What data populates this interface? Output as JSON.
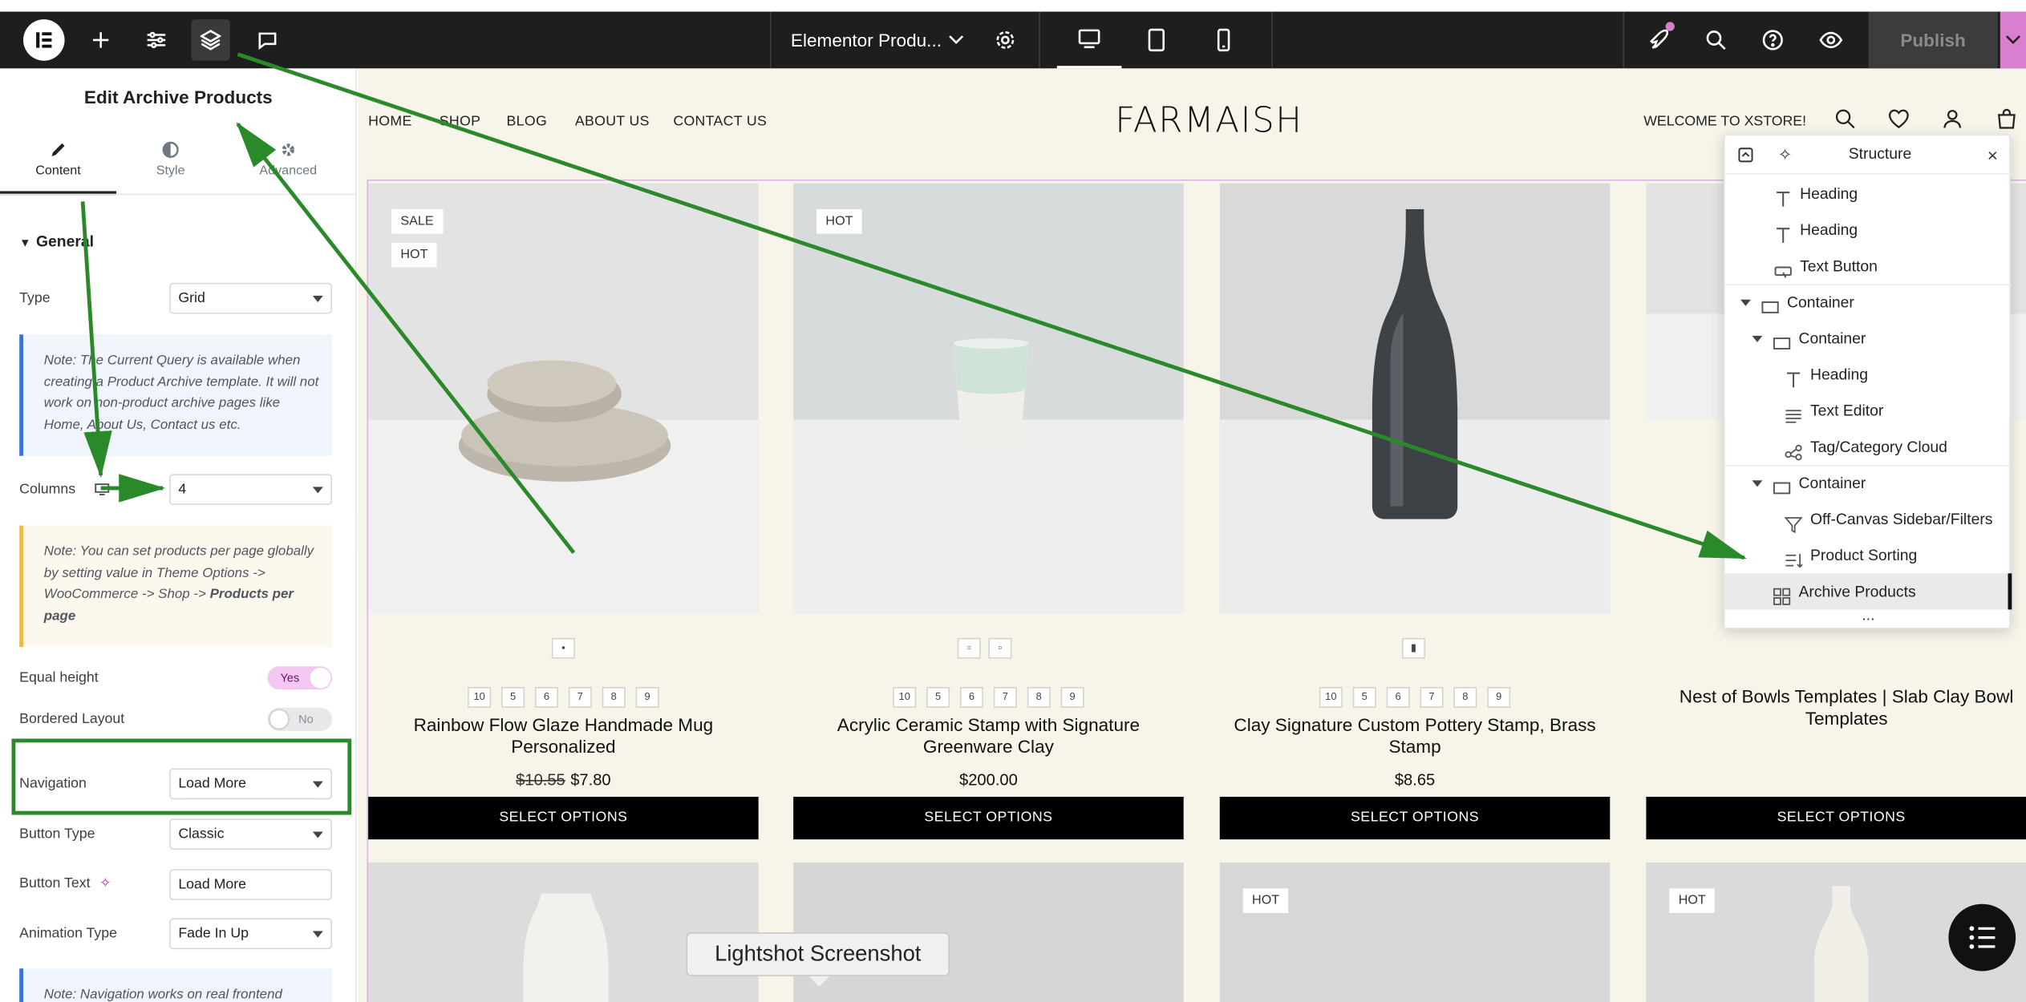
{
  "topbar": {
    "logo_letter": "E",
    "document_title": "Elementor Produ...",
    "publish_label": "Publish"
  },
  "panel": {
    "title": "Edit Archive Products",
    "tabs": [
      {
        "label": "Content",
        "icon": "pencil-icon"
      },
      {
        "label": "Style",
        "icon": "half-circle-icon"
      },
      {
        "label": "Advanced",
        "icon": "gear-icon"
      }
    ],
    "section_title": "General",
    "type_label": "Type",
    "type_value": "Grid",
    "note_query": "Note: The Current Query is available when creating a Product Archive template. It will not work on non-product archive pages like Home, About Us, Contact us etc.",
    "columns_label": "Columns",
    "columns_value": "4",
    "note_products_prefix": "Note: You can set products per page globally by setting value in Theme Options -> WooCommerce -> Shop -> ",
    "note_products_bold": "Products per page",
    "equal_height_label": "Equal height",
    "equal_height_value": "Yes",
    "bordered_label": "Bordered Layout",
    "bordered_value": "No",
    "navigation_label": "Navigation",
    "navigation_value": "Load More",
    "button_type_label": "Button Type",
    "button_type_value": "Classic",
    "button_text_label": "Button Text",
    "button_text_value": "Load More",
    "animation_label": "Animation Type",
    "animation_value": "Fade In Up",
    "note_navigation": "Note: Navigation works on real frontend"
  },
  "site": {
    "nav": [
      "HOME",
      "SHOP",
      "BLOG",
      "ABOUT US",
      "CONTACT US"
    ],
    "brand": "FARMAISH",
    "welcome": "WELCOME TO XSTORE!",
    "products": [
      {
        "name": "Rainbow Flow Glaze Handmade Mug Personalized",
        "old_price": "$10.55",
        "price": "$7.80",
        "badges": [
          "SALE",
          "HOT"
        ],
        "button": "SELECT OPTIONS"
      },
      {
        "name": "Acrylic Ceramic Stamp with Signature Greenware Clay",
        "old_price": "",
        "price": "$200.00",
        "badges": [
          "HOT"
        ],
        "button": "SELECT OPTIONS"
      },
      {
        "name": "Clay Signature Custom Pottery Stamp, Brass Stamp",
        "old_price": "",
        "price": "$8.65",
        "badges": [],
        "button": "SELECT OPTIONS"
      },
      {
        "name": "Nest of Bowls Templates | Slab Clay Bowl Templates",
        "old_price": "",
        "price": "",
        "badges": [],
        "button": "SELECT OPTIONS"
      }
    ],
    "sizes": [
      "10",
      "5",
      "6",
      "7",
      "8",
      "9"
    ],
    "row2_badges": [
      "HOT",
      "HOT"
    ]
  },
  "structure": {
    "title": "Structure",
    "items": [
      {
        "label": "Heading",
        "icon": "heading-icon"
      },
      {
        "label": "Heading",
        "icon": "heading-icon"
      },
      {
        "label": "Text Button",
        "icon": "button-icon"
      },
      {
        "label": "Container",
        "icon": "container-icon"
      },
      {
        "label": "Container",
        "icon": "container-icon"
      },
      {
        "label": "Heading",
        "icon": "heading-icon"
      },
      {
        "label": "Text Editor",
        "icon": "text-editor-icon"
      },
      {
        "label": "Tag/Category Cloud",
        "icon": "tag-cloud-icon"
      },
      {
        "label": "Container",
        "icon": "container-icon"
      },
      {
        "label": "Off-Canvas Sidebar/Filters",
        "icon": "filter-icon"
      },
      {
        "label": "Product Sorting",
        "icon": "sorting-icon"
      },
      {
        "label": "Archive Products",
        "icon": "archive-products-icon"
      }
    ],
    "more": "..."
  },
  "overlay": {
    "lightshot_label": "Lightshot Screenshot"
  },
  "colors": {
    "topbar": "#1e1e1e",
    "site_bg": "#f7f4ea",
    "annotation_green": "#2a8a2a",
    "accent_pink": "#d97fd0"
  }
}
